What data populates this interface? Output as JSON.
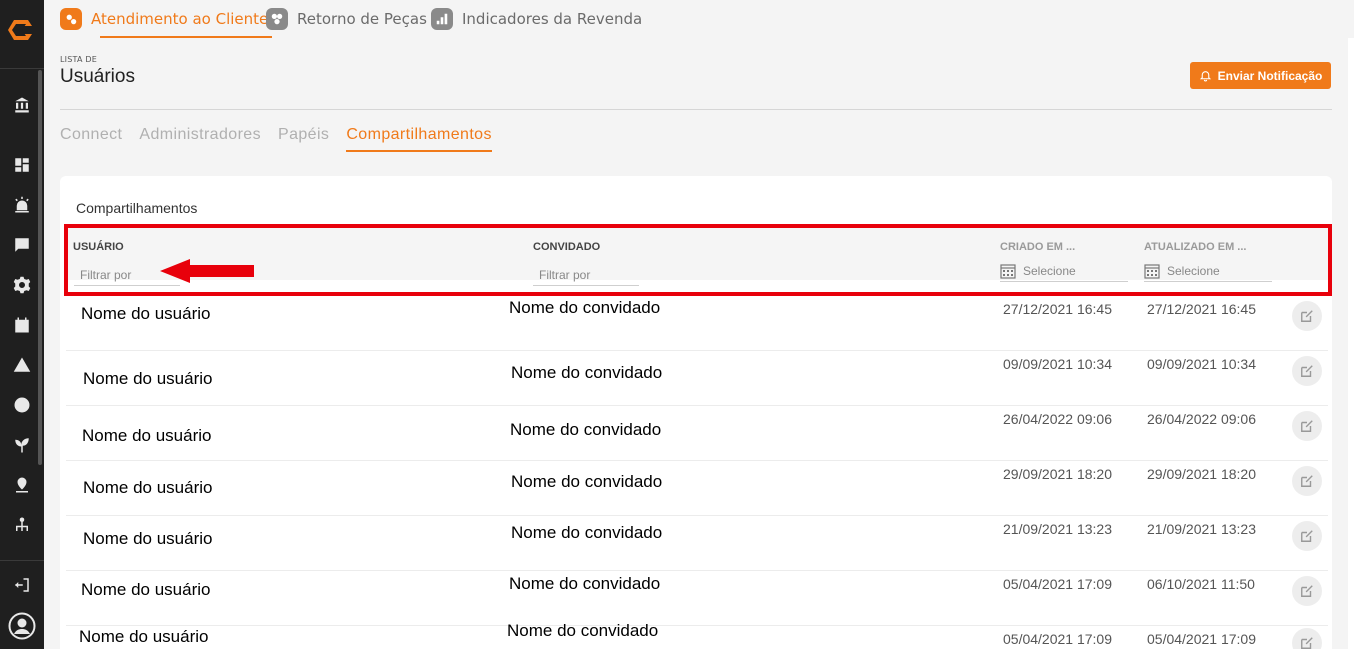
{
  "topnav": {
    "tabs": [
      {
        "label": "Atendimento ao Cliente",
        "icon": "customer-service-icon",
        "active": true
      },
      {
        "label": "Retorno de Peças",
        "icon": "parts-return-icon",
        "active": false
      },
      {
        "label": "Indicadores da Revenda",
        "icon": "bar-chart-icon",
        "active": false
      }
    ]
  },
  "sidebar": {
    "icons": [
      "logo-icon",
      "bank-icon",
      "dashboard-icon",
      "alarm-icon",
      "chat-icon",
      "settings-icon",
      "calendar-icon",
      "warning-icon",
      "globe-icon",
      "plant-icon",
      "location-icon",
      "hierarchy-icon",
      "logout-icon",
      "user-avatar-icon"
    ]
  },
  "page": {
    "eyebrow": "LISTA DE",
    "title": "Usuários",
    "notify_button": "Enviar Notificação"
  },
  "subtabs": [
    {
      "label": "Connect",
      "active": false
    },
    {
      "label": "Administradores",
      "active": false
    },
    {
      "label": "Papéis",
      "active": false
    },
    {
      "label": "Compartilhamentos",
      "active": true
    }
  ],
  "card": {
    "title": "Compartilhamentos",
    "columns": {
      "usuario": "USUÁRIO",
      "convidado": "CONVIDADO",
      "criado": "CRIADO EM ...",
      "atualizado": "ATUALIZADO EM ..."
    },
    "filters": {
      "usuario_placeholder": "Filtrar por",
      "convidado_placeholder": "Filtrar por",
      "criado_placeholder": "Selecione",
      "atualizado_placeholder": "Selecione"
    },
    "rows": [
      {
        "usuario": "Nome do usuário",
        "convidado": "Nome do convidado",
        "criado": "27/12/2021 16:45",
        "atualizado": "27/12/2021 16:45"
      },
      {
        "usuario": "Nome do usuário",
        "convidado": "Nome do convidado",
        "criado": "09/09/2021 10:34",
        "atualizado": "09/09/2021 10:34"
      },
      {
        "usuario": "Nome do usuário",
        "convidado": "Nome do convidado",
        "criado": "26/04/2022 09:06",
        "atualizado": "26/04/2022 09:06"
      },
      {
        "usuario": "Nome do usuário",
        "convidado": "Nome do convidado",
        "criado": "29/09/2021 18:20",
        "atualizado": "29/09/2021 18:20"
      },
      {
        "usuario": "Nome do usuário",
        "convidado": "Nome do convidado",
        "criado": "21/09/2021 13:23",
        "atualizado": "21/09/2021 13:23"
      },
      {
        "usuario": "Nome do usuário",
        "convidado": "Nome do convidado",
        "criado": "05/04/2021 17:09",
        "atualizado": "06/10/2021 11:50"
      },
      {
        "usuario": "Nome do usuário",
        "convidado": "Nome do convidado",
        "criado": "05/04/2021 17:09",
        "atualizado": "05/04/2021 17:09"
      }
    ]
  },
  "colors": {
    "accent": "#f07a1a",
    "sidebar_bg": "#1f1f1f",
    "highlight_red": "#e8000b"
  }
}
